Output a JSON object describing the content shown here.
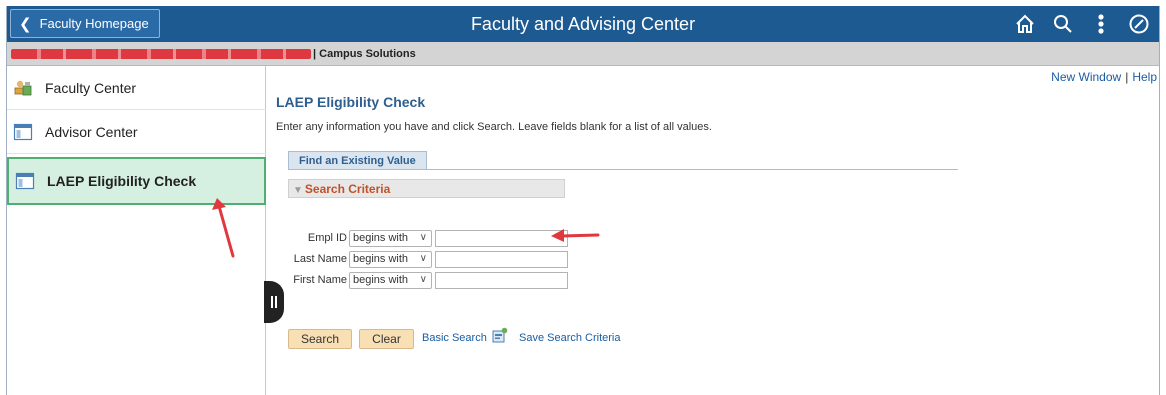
{
  "banner": {
    "home_label": "Faculty Homepage",
    "title": "Faculty and Advising Center",
    "icons": [
      "home-icon",
      "search-icon",
      "more-options-icon",
      "navbar-compass-icon"
    ]
  },
  "subbar": {
    "product": "| Campus Solutions"
  },
  "sidebar": {
    "items": [
      {
        "label": "Faculty Center",
        "icon": "faculty-center-icon"
      },
      {
        "label": "Advisor Center",
        "icon": "window-icon"
      },
      {
        "label": "LAEP Eligibility Check",
        "icon": "window-icon",
        "selected": true
      }
    ]
  },
  "main": {
    "links": {
      "new_window": "New Window",
      "help": "Help"
    },
    "title": "LAEP Eligibility Check",
    "instructions": "Enter any information you have and click Search. Leave fields blank for a list of all values.",
    "tab": "Find an Existing Value",
    "criteria_header": "Search Criteria",
    "fields": [
      {
        "label": "Empl ID",
        "operator": "begins with",
        "value": ""
      },
      {
        "label": "Last Name",
        "operator": "begins with",
        "value": ""
      },
      {
        "label": "First Name",
        "operator": "begins with",
        "value": ""
      }
    ],
    "buttons": {
      "search": "Search",
      "clear": "Clear",
      "basic_search": "Basic Search",
      "save_criteria": "Save Search Criteria"
    }
  },
  "colors": {
    "banner": "#1e5a92",
    "selected_nav_bg": "#d5f0e0",
    "selected_nav_border": "#4fae70",
    "button_bg": "#f8dfb4",
    "annotation_arrow": "#e0383e"
  }
}
